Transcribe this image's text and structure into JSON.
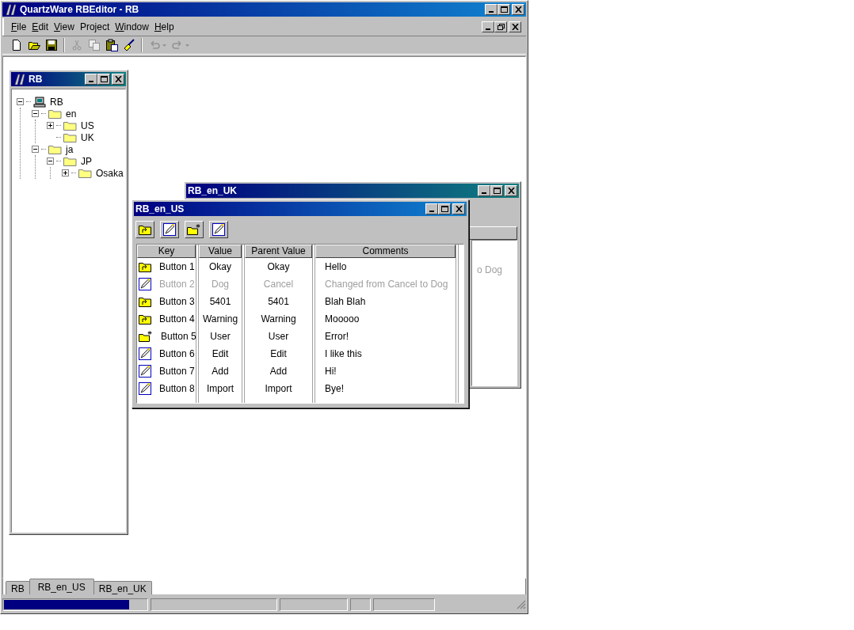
{
  "window": {
    "title": "QuartzWare RBEditor -  RB"
  },
  "menu": [
    {
      "label": "File",
      "underlined": true
    },
    {
      "label": "Edit",
      "underlined": true
    },
    {
      "label": "View",
      "underlined": true
    },
    {
      "label": "Project",
      "underlined": false
    },
    {
      "label": "Window",
      "underlined": true
    },
    {
      "label": "Help",
      "underlined": true
    }
  ],
  "toolbar": [
    {
      "kind": "new",
      "disabled": false
    },
    {
      "kind": "open",
      "disabled": false
    },
    {
      "kind": "save",
      "disabled": false
    },
    {
      "kind": "sep"
    },
    {
      "kind": "cut",
      "disabled": true
    },
    {
      "kind": "copy",
      "disabled": true
    },
    {
      "kind": "paste",
      "disabled": false
    },
    {
      "kind": "brush",
      "disabled": false
    },
    {
      "kind": "sep"
    },
    {
      "kind": "undo",
      "disabled": true
    },
    {
      "kind": "redo",
      "disabled": true
    }
  ],
  "tree_window": {
    "title": "RB",
    "maximized": false,
    "tree": [
      {
        "label": "RB",
        "kind": "computer",
        "expanded": true,
        "children": [
          {
            "label": "en",
            "kind": "folder",
            "expanded": true,
            "children": [
              {
                "label": "US",
                "kind": "folder",
                "expanded": false,
                "has_children": true
              },
              {
                "label": "UK",
                "kind": "folder",
                "has_children": false
              }
            ]
          },
          {
            "label": "ja",
            "kind": "folder",
            "expanded": true,
            "children": [
              {
                "label": "JP",
                "kind": "folder",
                "expanded": true,
                "children": [
                  {
                    "label": "Osaka",
                    "kind": "folder",
                    "expanded": false,
                    "has_children": true
                  }
                ]
              }
            ]
          }
        ]
      }
    ]
  },
  "back_window": {
    "title": "RB_en_UK",
    "maximized": false,
    "visible_text": "o Dog"
  },
  "front_window": {
    "title": "RB_en_US",
    "maximized": false,
    "tools": [
      {
        "kind": "folder-up"
      },
      {
        "kind": "edit"
      },
      {
        "kind": "new-folder"
      },
      {
        "kind": "edit"
      }
    ],
    "columns": [
      "Key",
      "Value",
      "Parent Value",
      "Comments"
    ],
    "rows": [
      {
        "kind": "folder-up",
        "disabled": false,
        "cells": [
          "Button 1",
          "Okay",
          "Okay",
          "Hello"
        ]
      },
      {
        "kind": "edit",
        "disabled": true,
        "cells": [
          "Button 2",
          "Dog",
          "Cancel",
          "Changed from Cancel to Dog"
        ]
      },
      {
        "kind": "folder-up",
        "disabled": false,
        "cells": [
          "Button 3",
          "5401",
          "5401",
          "Blah Blah"
        ]
      },
      {
        "kind": "folder-up",
        "disabled": false,
        "cells": [
          "Button 4",
          "Warning",
          "Warning",
          "Mooooo"
        ]
      },
      {
        "kind": "new-folder",
        "disabled": false,
        "cells": [
          "Button 5",
          "User",
          "User",
          "Error!"
        ]
      },
      {
        "kind": "edit",
        "disabled": false,
        "cells": [
          "Button 6",
          "Edit",
          "Edit",
          "I like this"
        ]
      },
      {
        "kind": "edit",
        "disabled": false,
        "cells": [
          "Button 7",
          "Add",
          "Add",
          "Hi!"
        ]
      },
      {
        "kind": "edit",
        "disabled": false,
        "cells": [
          "Button 8",
          "Import",
          "Import",
          "Bye!"
        ]
      }
    ]
  },
  "tabs": [
    {
      "label": "RB",
      "selected": false
    },
    {
      "label": "RB_en_US",
      "selected": true
    },
    {
      "label": "RB_en_UK",
      "selected": false
    }
  ],
  "status_bar": {
    "progress": {
      "level": 0.88
    }
  }
}
